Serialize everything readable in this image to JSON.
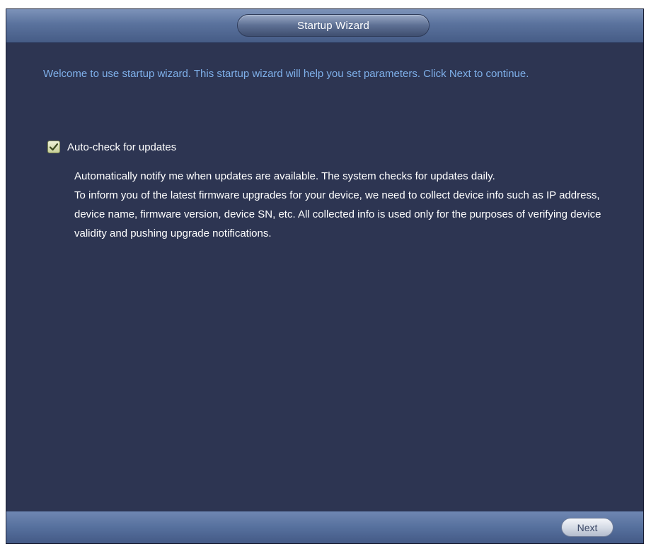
{
  "window": {
    "title": "Startup Wizard"
  },
  "intro": {
    "text": "Welcome to use startup wizard. This startup wizard will help you set parameters. Click Next to continue."
  },
  "auto_check": {
    "label": "Auto-check for updates",
    "checked": true,
    "description_1": "Automatically notify me when updates are available. The system checks for updates daily.",
    "description_2": "To inform you of the latest firmware upgrades for your device, we need to collect device info such as IP address, device name, firmware version, device SN, etc. All collected info is used only for the purposes of verifying device validity and pushing upgrade notifications."
  },
  "footer": {
    "next_label": "Next"
  },
  "colors": {
    "background": "#2d3552",
    "intro_text": "#7fb0ea",
    "bar": "#56709d"
  }
}
